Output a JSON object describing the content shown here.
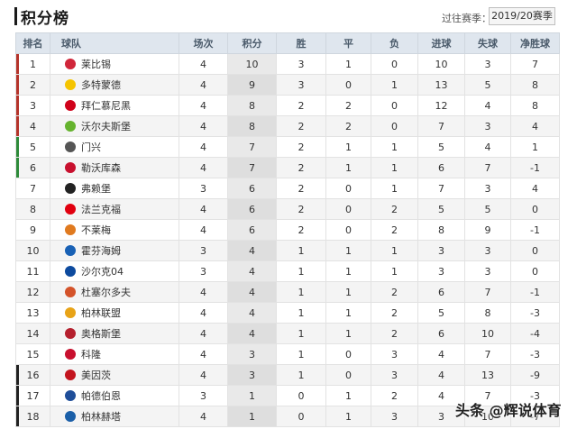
{
  "header": {
    "title": "积分榜",
    "season_label": "过往赛季：",
    "season_value": "2019/20赛季"
  },
  "columns": [
    "排名",
    "球队",
    "场次",
    "积分",
    "胜",
    "平",
    "负",
    "进球",
    "失球",
    "净胜球"
  ],
  "rows": [
    {
      "rank": "1",
      "team": "莱比锡",
      "played": "4",
      "points": "10",
      "w": "3",
      "d": "1",
      "l": "0",
      "gf": "10",
      "ga": "3",
      "gd": "7",
      "mark": "#b5342b",
      "badge": "#d0263a"
    },
    {
      "rank": "2",
      "team": "多特蒙德",
      "played": "4",
      "points": "9",
      "w": "3",
      "d": "0",
      "l": "1",
      "gf": "13",
      "ga": "5",
      "gd": "8",
      "mark": "#b5342b",
      "badge": "#f5c400"
    },
    {
      "rank": "3",
      "team": "拜仁慕尼黑",
      "played": "4",
      "points": "8",
      "w": "2",
      "d": "2",
      "l": "0",
      "gf": "12",
      "ga": "4",
      "gd": "8",
      "mark": "#b5342b",
      "badge": "#d0021b"
    },
    {
      "rank": "4",
      "team": "沃尔夫斯堡",
      "played": "4",
      "points": "8",
      "w": "2",
      "d": "2",
      "l": "0",
      "gf": "7",
      "ga": "3",
      "gd": "4",
      "mark": "#b5342b",
      "badge": "#65b32e"
    },
    {
      "rank": "5",
      "team": "门兴",
      "played": "4",
      "points": "7",
      "w": "2",
      "d": "1",
      "l": "1",
      "gf": "5",
      "ga": "4",
      "gd": "1",
      "mark": "#2e8b3a",
      "badge": "#555555"
    },
    {
      "rank": "6",
      "team": "勒沃库森",
      "played": "4",
      "points": "7",
      "w": "2",
      "d": "1",
      "l": "1",
      "gf": "6",
      "ga": "7",
      "gd": "-1",
      "mark": "#2e8b3a",
      "badge": "#c8102e"
    },
    {
      "rank": "7",
      "team": "弗赖堡",
      "played": "3",
      "points": "6",
      "w": "2",
      "d": "0",
      "l": "1",
      "gf": "7",
      "ga": "3",
      "gd": "4",
      "mark": "",
      "badge": "#222222"
    },
    {
      "rank": "8",
      "team": "法兰克福",
      "played": "4",
      "points": "6",
      "w": "2",
      "d": "0",
      "l": "2",
      "gf": "5",
      "ga": "5",
      "gd": "0",
      "mark": "",
      "badge": "#e1000f"
    },
    {
      "rank": "9",
      "team": "不莱梅",
      "played": "4",
      "points": "6",
      "w": "2",
      "d": "0",
      "l": "2",
      "gf": "8",
      "ga": "9",
      "gd": "-1",
      "mark": "",
      "badge": "#e07a1f"
    },
    {
      "rank": "10",
      "team": "霍芬海姆",
      "played": "3",
      "points": "4",
      "w": "1",
      "d": "1",
      "l": "1",
      "gf": "3",
      "ga": "3",
      "gd": "0",
      "mark": "",
      "badge": "#1961b5"
    },
    {
      "rank": "11",
      "team": "沙尔克04",
      "played": "3",
      "points": "4",
      "w": "1",
      "d": "1",
      "l": "1",
      "gf": "3",
      "ga": "3",
      "gd": "0",
      "mark": "",
      "badge": "#0d4a9e"
    },
    {
      "rank": "12",
      "team": "杜塞尔多夫",
      "played": "4",
      "points": "4",
      "w": "1",
      "d": "1",
      "l": "2",
      "gf": "6",
      "ga": "7",
      "gd": "-1",
      "mark": "",
      "badge": "#d4532a"
    },
    {
      "rank": "13",
      "team": "柏林联盟",
      "played": "4",
      "points": "4",
      "w": "1",
      "d": "1",
      "l": "2",
      "gf": "5",
      "ga": "8",
      "gd": "-3",
      "mark": "",
      "badge": "#e8a317"
    },
    {
      "rank": "14",
      "team": "奥格斯堡",
      "played": "4",
      "points": "4",
      "w": "1",
      "d": "1",
      "l": "2",
      "gf": "6",
      "ga": "10",
      "gd": "-4",
      "mark": "",
      "badge": "#b5202e"
    },
    {
      "rank": "15",
      "team": "科隆",
      "played": "4",
      "points": "3",
      "w": "1",
      "d": "0",
      "l": "3",
      "gf": "4",
      "ga": "7",
      "gd": "-3",
      "mark": "",
      "badge": "#c8102e"
    },
    {
      "rank": "16",
      "team": "美因茨",
      "played": "4",
      "points": "3",
      "w": "1",
      "d": "0",
      "l": "3",
      "gf": "4",
      "ga": "13",
      "gd": "-9",
      "mark": "#222222",
      "badge": "#c3141e"
    },
    {
      "rank": "17",
      "team": "帕德伯恩",
      "played": "3",
      "points": "1",
      "w": "0",
      "d": "1",
      "l": "2",
      "gf": "4",
      "ga": "7",
      "gd": "-3",
      "mark": "#222222",
      "badge": "#1f4e99"
    },
    {
      "rank": "18",
      "team": "柏林赫塔",
      "played": "4",
      "points": "1",
      "w": "0",
      "d": "1",
      "l": "3",
      "gf": "3",
      "ga": "10",
      "gd": "-7",
      "mark": "#222222",
      "badge": "#1b5fa8"
    }
  ],
  "watermark": "头条 @辉说体育"
}
